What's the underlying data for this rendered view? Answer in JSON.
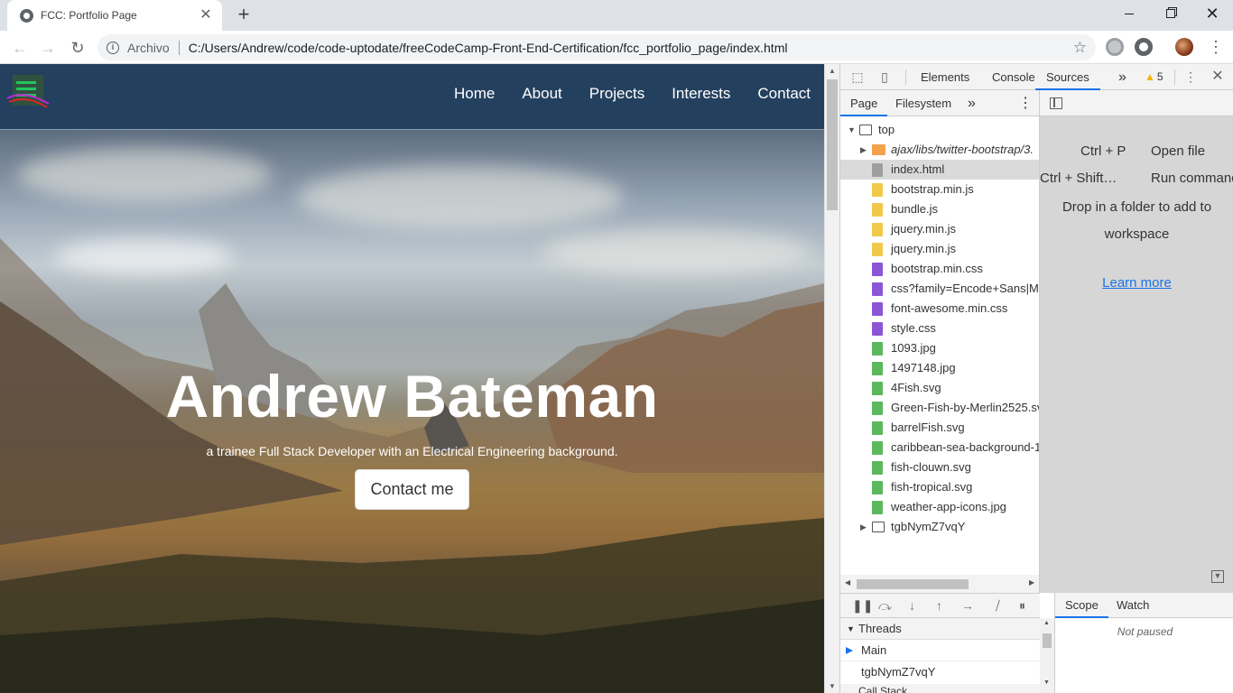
{
  "browser": {
    "tab_title": "FCC: Portfolio Page",
    "tab_close": "✕",
    "new_tab": "+",
    "url_scheme": "Archivo",
    "url": "C:/Users/Andrew/code/code-uptodate/freeCodeCamp-Front-End-Certification/fcc_portfolio_page/index.html"
  },
  "site": {
    "nav": [
      "Home",
      "About",
      "Projects",
      "Interests",
      "Contact"
    ],
    "hero_title": "Andrew Bateman",
    "hero_subtitle": "a trainee Full Stack Developer with an Electrical Engineering background.",
    "cta_label": "Contact me"
  },
  "devtools": {
    "tabs": [
      "Elements",
      "Console",
      "Sources"
    ],
    "active_tab": "Sources",
    "more_tabs": "»",
    "warning_count": "5",
    "subtabs": [
      "Page",
      "Filesystem"
    ],
    "tree": [
      {
        "label": "top",
        "type": "frame",
        "level": 0,
        "expanded": true
      },
      {
        "label": "ajax/libs/twitter-bootstrap/3.",
        "type": "folder",
        "level": 1,
        "collapsed": true
      },
      {
        "label": "index.html",
        "type": "html",
        "level": 1,
        "selected": true
      },
      {
        "label": "bootstrap.min.js",
        "type": "js",
        "level": 1
      },
      {
        "label": "bundle.js",
        "type": "js",
        "level": 1
      },
      {
        "label": "jquery.min.js",
        "type": "js",
        "level": 1
      },
      {
        "label": "jquery.min.js",
        "type": "js",
        "level": 1
      },
      {
        "label": "bootstrap.min.css",
        "type": "css",
        "level": 1
      },
      {
        "label": "css?family=Encode+Sans|Ma",
        "type": "css",
        "level": 1
      },
      {
        "label": "font-awesome.min.css",
        "type": "css",
        "level": 1
      },
      {
        "label": "style.css",
        "type": "css",
        "level": 1
      },
      {
        "label": "1093.jpg",
        "type": "img",
        "level": 1
      },
      {
        "label": "1497148.jpg",
        "type": "img",
        "level": 1
      },
      {
        "label": "4Fish.svg",
        "type": "img",
        "level": 1
      },
      {
        "label": "Green-Fish-by-Merlin2525.sv",
        "type": "img",
        "level": 1
      },
      {
        "label": "barrelFish.svg",
        "type": "img",
        "level": 1
      },
      {
        "label": "caribbean-sea-background-1",
        "type": "img",
        "level": 1
      },
      {
        "label": "fish-clouwn.svg",
        "type": "img",
        "level": 1
      },
      {
        "label": "fish-tropical.svg",
        "type": "img",
        "level": 1
      },
      {
        "label": "weather-app-icons.jpg",
        "type": "img",
        "level": 1
      },
      {
        "label": "tgbNymZ7vqY",
        "type": "frame",
        "level": 1,
        "collapsed": true
      }
    ],
    "shortcuts": [
      {
        "keys": "Ctrl + P",
        "action": "Open file"
      },
      {
        "keys": "Ctrl + Shift…",
        "action": "Run command"
      }
    ],
    "drop_text": "Drop in a folder to add to workspace",
    "learn_more": "Learn more",
    "threads_header": "Threads",
    "threads": [
      "Main",
      "tgbNymZ7vqY"
    ],
    "next_section": "Call Stack",
    "scope_tabs": [
      "Scope",
      "Watch"
    ],
    "not_paused": "Not paused"
  }
}
